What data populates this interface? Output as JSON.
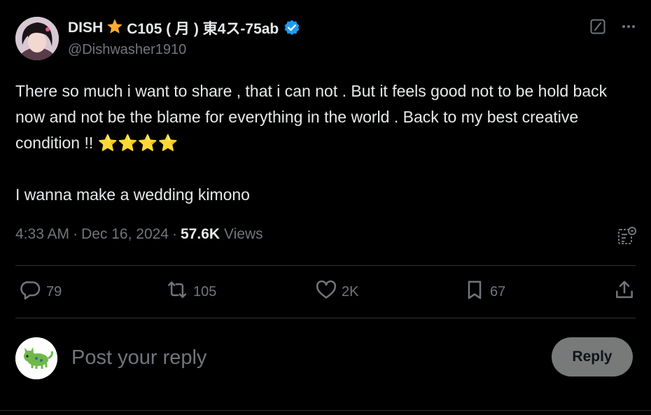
{
  "author": {
    "name_prefix": "DISH",
    "name_suffix": "C105 ( 月 ) 東4ス-75ab",
    "handle": "@Dishwasher1910"
  },
  "tweet": {
    "text": "There so much i want to share , that i can not . But it feels good not to be hold back now and not be the blame for everything in the world . Back to my best creative condition !! ⭐⭐⭐⭐\n\nI wanna make a wedding kimono",
    "time": "4:33 AM",
    "date": "Dec 16, 2024",
    "views_count": "57.6K",
    "views_label": "Views"
  },
  "stats": {
    "replies": "79",
    "reposts": "105",
    "likes": "2K",
    "bookmarks": "67"
  },
  "reply": {
    "placeholder": "Post your reply",
    "button_label": "Reply"
  },
  "colors": {
    "background": "#000000",
    "text": "#e7e9ea",
    "muted": "#71767b",
    "verified": "#1d9bf0",
    "star": "#ffac33",
    "reply_button": "#787a7a"
  },
  "icons": [
    "star-emoji-icon",
    "verified-badge-icon",
    "grok-icon",
    "more-icon",
    "analytics-icon",
    "reply-icon",
    "repost-icon",
    "like-icon",
    "bookmark-icon",
    "share-icon"
  ]
}
